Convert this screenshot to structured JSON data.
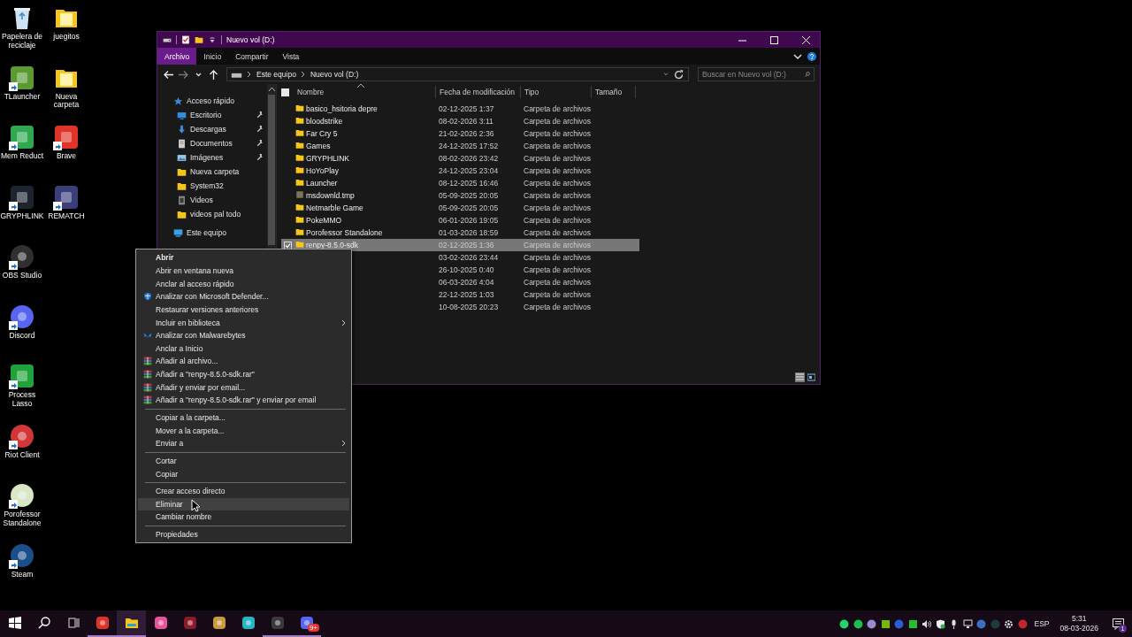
{
  "desktop_icons": [
    {
      "label": "Papelera de reciclaje",
      "kind": "recycle",
      "shortcut": false
    },
    {
      "label": "TLauncher",
      "kind": "tile",
      "color": "#5a9a30",
      "shortcut": true
    },
    {
      "label": "Mem Reduct",
      "kind": "tile",
      "color": "#2fa84f",
      "shortcut": true
    },
    {
      "label": "GRYPHLINK",
      "kind": "tile",
      "color": "#1c2430",
      "shortcut": true
    },
    {
      "label": "OBS Studio",
      "kind": "round",
      "color": "#303030",
      "shortcut": true
    },
    {
      "label": "Discord",
      "kind": "round",
      "color": "#5865f2",
      "shortcut": true
    },
    {
      "label": "Process Lasso",
      "kind": "tile",
      "color": "#1fa23a",
      "shortcut": true
    },
    {
      "label": "Riot Client",
      "kind": "round",
      "color": "#d13639",
      "shortcut": true
    },
    {
      "label": "Porofessor Standalone",
      "kind": "round",
      "color": "#d9e6c8",
      "shortcut": true
    },
    {
      "label": "Steam",
      "kind": "round",
      "color": "#1b4f8a",
      "shortcut": true
    },
    {
      "label": "juegitos",
      "kind": "folder",
      "shortcut": false
    },
    {
      "label": "Nueva carpeta",
      "kind": "folder",
      "shortcut": false
    },
    {
      "label": "Brave",
      "kind": "tile",
      "color": "#e0332a",
      "shortcut": true
    },
    {
      "label": "REMATCH",
      "kind": "tile",
      "color": "#3a3f7a",
      "shortcut": true
    }
  ],
  "window": {
    "title": "Nuevo vol (D:)",
    "ribbon_tabs": [
      {
        "label": "Archivo",
        "kind": "file"
      },
      {
        "label": "Inicio",
        "kind": "tab"
      },
      {
        "label": "Compartir",
        "kind": "tab"
      },
      {
        "label": "Vista",
        "kind": "tab"
      }
    ],
    "address": [
      "Este equipo",
      "Nuevo vol (D:)"
    ],
    "search": {
      "placeholder": "Buscar en Nuevo vol (D:)"
    },
    "nav": [
      {
        "label": "Acceso rápido",
        "kind": "star",
        "children": [
          {
            "label": "Escritorio",
            "kind": "desktop",
            "pinned": true
          },
          {
            "label": "Descargas",
            "kind": "download",
            "pinned": true
          },
          {
            "label": "Documentos",
            "kind": "document",
            "pinned": true
          },
          {
            "label": "Imágenes",
            "kind": "image",
            "pinned": true
          },
          {
            "label": "Nueva carpeta",
            "kind": "folder",
            "pinned": false
          },
          {
            "label": "System32",
            "kind": "folder",
            "pinned": false
          },
          {
            "label": "Videos",
            "kind": "video",
            "pinned": false
          },
          {
            "label": "videos pal todo",
            "kind": "folder",
            "pinned": false
          }
        ]
      },
      {
        "label": "Este equipo",
        "kind": "pc"
      }
    ],
    "select_all": {
      "checked": false
    },
    "columns": [
      "Nombre",
      "Fecha de modificación",
      "Tipo",
      "Tamaño"
    ],
    "files": [
      {
        "name": "basico_hsitoria depre",
        "date": "02-12-2025 1:37",
        "type": "Carpeta de archivos",
        "kind": "folder",
        "selected": false
      },
      {
        "name": "bloodstrike",
        "date": "08-02-2026 3:11",
        "type": "Carpeta de archivos",
        "kind": "folder",
        "selected": false
      },
      {
        "name": "Far Cry 5",
        "date": "21-02-2026 2:36",
        "type": "Carpeta de archivos",
        "kind": "folder",
        "selected": false
      },
      {
        "name": "Games",
        "date": "24-12-2025 17:52",
        "type": "Carpeta de archivos",
        "kind": "folder",
        "selected": false
      },
      {
        "name": "GRYPHLINK",
        "date": "08-02-2026 23:42",
        "type": "Carpeta de archivos",
        "kind": "folder",
        "selected": false
      },
      {
        "name": "HoYoPlay",
        "date": "24-12-2025 23:04",
        "type": "Carpeta de archivos",
        "kind": "folder",
        "selected": false
      },
      {
        "name": "Launcher",
        "date": "08-12-2025 16:46",
        "type": "Carpeta de archivos",
        "kind": "folder",
        "selected": false
      },
      {
        "name": "msdownld.tmp",
        "date": "05-09-2025 20:05",
        "type": "Carpeta de archivos",
        "kind": "file",
        "selected": false
      },
      {
        "name": "Netmarble Game",
        "date": "05-09-2025 20:05",
        "type": "Carpeta de archivos",
        "kind": "folder",
        "selected": false
      },
      {
        "name": "PokeMMO",
        "date": "06-01-2026 19:05",
        "type": "Carpeta de archivos",
        "kind": "folder",
        "selected": false
      },
      {
        "name": "Porofessor Standalone",
        "date": "01-03-2026 18:59",
        "type": "Carpeta de archivos",
        "kind": "folder",
        "selected": false
      },
      {
        "name": "renpy-8.5.0-sdk",
        "date": "02-12-2025 1:36",
        "type": "Carpeta de archivos",
        "kind": "folder",
        "selected": true
      },
      {
        "date": "03-02-2026 23:44",
        "type": "Carpeta de archivos",
        "selected": false
      },
      {
        "date": "26-10-2025 0:40",
        "type": "Carpeta de archivos",
        "selected": false
      },
      {
        "date": "06-03-2026 4:04",
        "type": "Carpeta de archivos",
        "selected": false
      },
      {
        "date": "22-12-2025 1:03",
        "type": "Carpeta de archivos",
        "selected": false
      },
      {
        "date": "10-08-2025 20:23",
        "type": "Carpeta de archivos",
        "selected": false
      }
    ],
    "views": [
      {
        "kind": "details",
        "selected": true
      },
      {
        "kind": "tiles",
        "selected": false
      }
    ]
  },
  "context_menu": [
    {
      "kind": "plain",
      "label": "Abrir",
      "default": true,
      "highlighted": false,
      "submenu": false
    },
    {
      "kind": "plain",
      "label": "Abrir en ventana nueva",
      "default": false,
      "highlighted": false,
      "submenu": false
    },
    {
      "kind": "plain",
      "label": "Anclar al acceso rápido",
      "default": false,
      "highlighted": false,
      "submenu": false
    },
    {
      "kind": "shield",
      "label": "Analizar con Microsoft Defender...",
      "default": false,
      "highlighted": false,
      "submenu": false
    },
    {
      "kind": "plain",
      "label": "Restaurar versiones anteriores",
      "default": false,
      "highlighted": false,
      "submenu": false
    },
    {
      "kind": "plain",
      "label": "Incluir en biblioteca",
      "default": false,
      "highlighted": false,
      "submenu": true
    },
    {
      "kind": "wings",
      "label": "Analizar con Malwarebytes",
      "default": false,
      "highlighted": false,
      "submenu": false
    },
    {
      "kind": "plain",
      "label": "Anclar a Inicio",
      "default": false,
      "highlighted": false,
      "submenu": false
    },
    {
      "kind": "books",
      "label": "Añadir al archivo...",
      "default": false,
      "highlighted": false,
      "submenu": false
    },
    {
      "kind": "books",
      "label": "Añadir a \"renpy-8.5.0-sdk.rar\"",
      "default": false,
      "highlighted": false,
      "submenu": false
    },
    {
      "kind": "books",
      "label": "Añadir y enviar por email...",
      "default": false,
      "highlighted": false,
      "submenu": false
    },
    {
      "kind": "books",
      "label": "Añadir a \"renpy-8.5.0-sdk.rar\" y enviar por email",
      "default": false,
      "highlighted": false,
      "submenu": false
    },
    {
      "kind": "separator"
    },
    {
      "kind": "plain",
      "label": "Copiar a la carpeta...",
      "default": false,
      "highlighted": false,
      "submenu": false
    },
    {
      "kind": "plain",
      "label": "Mover a la carpeta...",
      "default": false,
      "highlighted": false,
      "submenu": false
    },
    {
      "kind": "plain",
      "label": "Enviar a",
      "default": false,
      "highlighted": false,
      "submenu": true
    },
    {
      "kind": "separator"
    },
    {
      "kind": "plain",
      "label": "Cortar",
      "default": false,
      "highlighted": false,
      "submenu": false
    },
    {
      "kind": "plain",
      "label": "Copiar",
      "default": false,
      "highlighted": false,
      "submenu": false
    },
    {
      "kind": "separator"
    },
    {
      "kind": "plain",
      "label": "Crear acceso directo",
      "default": false,
      "highlighted": false,
      "submenu": false
    },
    {
      "kind": "plain",
      "label": "Eliminar",
      "default": false,
      "highlighted": true,
      "submenu": false
    },
    {
      "kind": "plain",
      "label": "Cambiar nombre",
      "default": false,
      "highlighted": false,
      "submenu": false
    },
    {
      "kind": "separator"
    },
    {
      "kind": "plain",
      "label": "Propiedades",
      "default": false,
      "highlighted": false,
      "submenu": false
    }
  ],
  "taskbar": {
    "buttons": [
      {
        "kind": "start",
        "running": false,
        "active": false
      },
      {
        "kind": "search",
        "running": false,
        "active": false
      },
      {
        "kind": "taskview",
        "running": false,
        "active": false
      },
      {
        "kind": "app",
        "color": "#e0332a",
        "running": true,
        "active": false
      },
      {
        "kind": "folder",
        "running": true,
        "active": true
      },
      {
        "kind": "app",
        "color": "#e8539a",
        "running": false,
        "active": false
      },
      {
        "kind": "app",
        "color": "#8c1a2a",
        "running": false,
        "active": false
      },
      {
        "kind": "app",
        "color": "#c89b3c",
        "running": false,
        "active": false
      },
      {
        "kind": "app",
        "color": "#27b5c4",
        "running": false,
        "active": false
      },
      {
        "kind": "app",
        "color": "#3a3a3a",
        "running": true,
        "active": false
      },
      {
        "kind": "app",
        "color": "#5865f2",
        "running": true,
        "active": false,
        "badge": "9+"
      }
    ],
    "tray": [
      {
        "kind": "circle",
        "color": "#25d366"
      },
      {
        "kind": "circle",
        "color": "#1fbf4f"
      },
      {
        "kind": "circle",
        "color": "#9a8ad0"
      },
      {
        "kind": "square",
        "color": "#76b900"
      },
      {
        "kind": "circle",
        "color": "#2b5bd7"
      },
      {
        "kind": "square",
        "color": "#22c02a"
      },
      {
        "kind": "speaker"
      },
      {
        "kind": "shield"
      },
      {
        "kind": "mic"
      },
      {
        "kind": "monitor"
      },
      {
        "kind": "circle",
        "color": "#3b6fc4"
      },
      {
        "kind": "circle",
        "color": "#1e3c3c"
      },
      {
        "kind": "gear"
      },
      {
        "kind": "circle",
        "color": "#c0262a"
      }
    ],
    "language": "ESP",
    "time": "5:31",
    "date": "08-03-2026",
    "notifications": "1"
  }
}
